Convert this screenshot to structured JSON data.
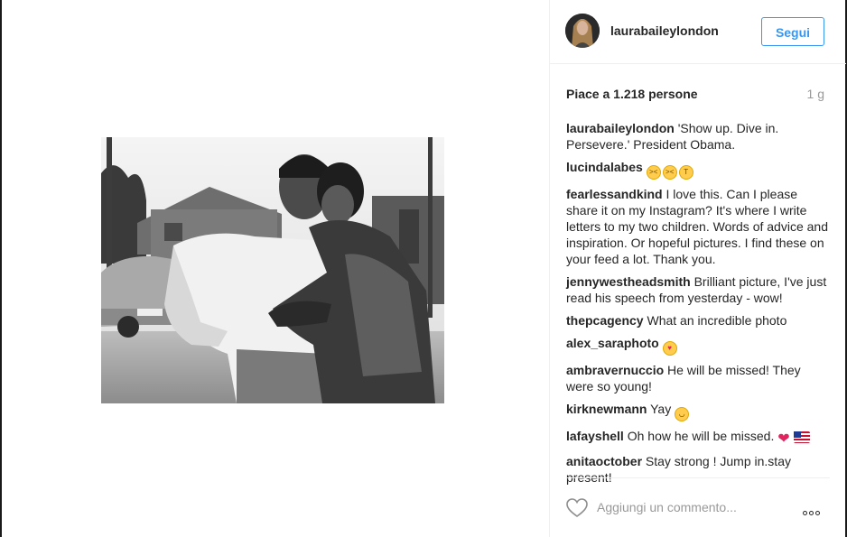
{
  "post": {
    "username": "laurabaileylondon",
    "follow_label": "Segui",
    "likes": "Piace a 1.218 persone",
    "age": "1 g"
  },
  "comments": [
    {
      "user": "laurabaileylondon",
      "text": " 'Show up. Dive in. Persevere.' President Obama.",
      "emojis": []
    },
    {
      "user": "lucindalabes",
      "text": " ",
      "emojis": [
        "weary-face-icon",
        "weary-face-icon",
        "crying-face-icon"
      ]
    },
    {
      "user": "fearlessandkind",
      "text": " I love this. Can I please share it on my Instagram? It's where I write letters to my two children. Words of advice and inspiration. Or hopeful pictures. I find these on your feed a lot. Thank you.",
      "emojis": []
    },
    {
      "user": "jennywestheadsmith",
      "text": " Brilliant picture, I've just read his speech from yesterday - wow!",
      "emojis": []
    },
    {
      "user": "thepcagency",
      "text": " What an incredible photo",
      "emojis": []
    },
    {
      "user": "alex_saraphoto",
      "text": " ",
      "emojis": [
        "heart-eyes-icon"
      ]
    },
    {
      "user": "ambravernuccio",
      "text": " He will be missed! They were so young!",
      "emojis": []
    },
    {
      "user": "kirknewmann",
      "text": " Yay ",
      "emojis": [
        "relieved-face-icon"
      ]
    },
    {
      "user": "lafayshell",
      "text": " Oh how he will be missed. ",
      "emojis": [
        "red-heart-icon",
        "us-flag-icon"
      ]
    },
    {
      "user": "anitaoctober",
      "text": " Stay strong ! Jump in.stay present!",
      "emojis": []
    }
  ],
  "add_comment_placeholder": "Aggiungi un commento...",
  "colors": {
    "accent": "#3897f0",
    "muted": "#999999",
    "text": "#262626"
  }
}
